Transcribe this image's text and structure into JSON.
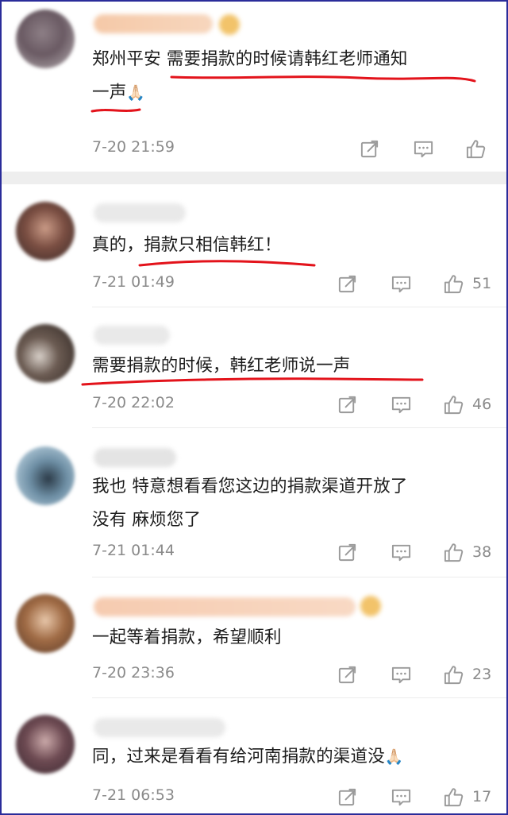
{
  "colors": {
    "underline": "#e3131b",
    "icon": "#9a9a9a",
    "meta_text": "#8a8a8a",
    "frame_border": "#2a2c9a",
    "badge": "#f2c36a"
  },
  "icons": {
    "share": "share-icon",
    "comment": "comment-icon",
    "like": "thumbs-up-icon",
    "pray": "folded-hands-emoji"
  },
  "comments": [
    {
      "text_line1": "郑州平安 需要捐款的时候请韩红老师通知",
      "text_line2": "一声",
      "emoji": "🙏🏻",
      "time": "7-20 21:59",
      "likes": ""
    },
    {
      "text": "真的，捐款只相信韩红！",
      "time": "7-21 01:49",
      "likes": "51"
    },
    {
      "text": "需要捐款的时候，韩红老师说一声",
      "time": "7-20 22:02",
      "likes": "46"
    },
    {
      "text_line1": "我也 特意想看看您这边的捐款渠道开放了",
      "text_line2": "没有 麻烦您了",
      "time": "7-21 01:44",
      "likes": "38"
    },
    {
      "text": "一起等着捐款，希望顺利",
      "time": "7-20 23:36",
      "likes": "23"
    },
    {
      "text": "同，过来是看看有给河南捐款的渠道没",
      "emoji": "🙏🏻",
      "time": "7-21 06:53",
      "likes": "17"
    }
  ]
}
